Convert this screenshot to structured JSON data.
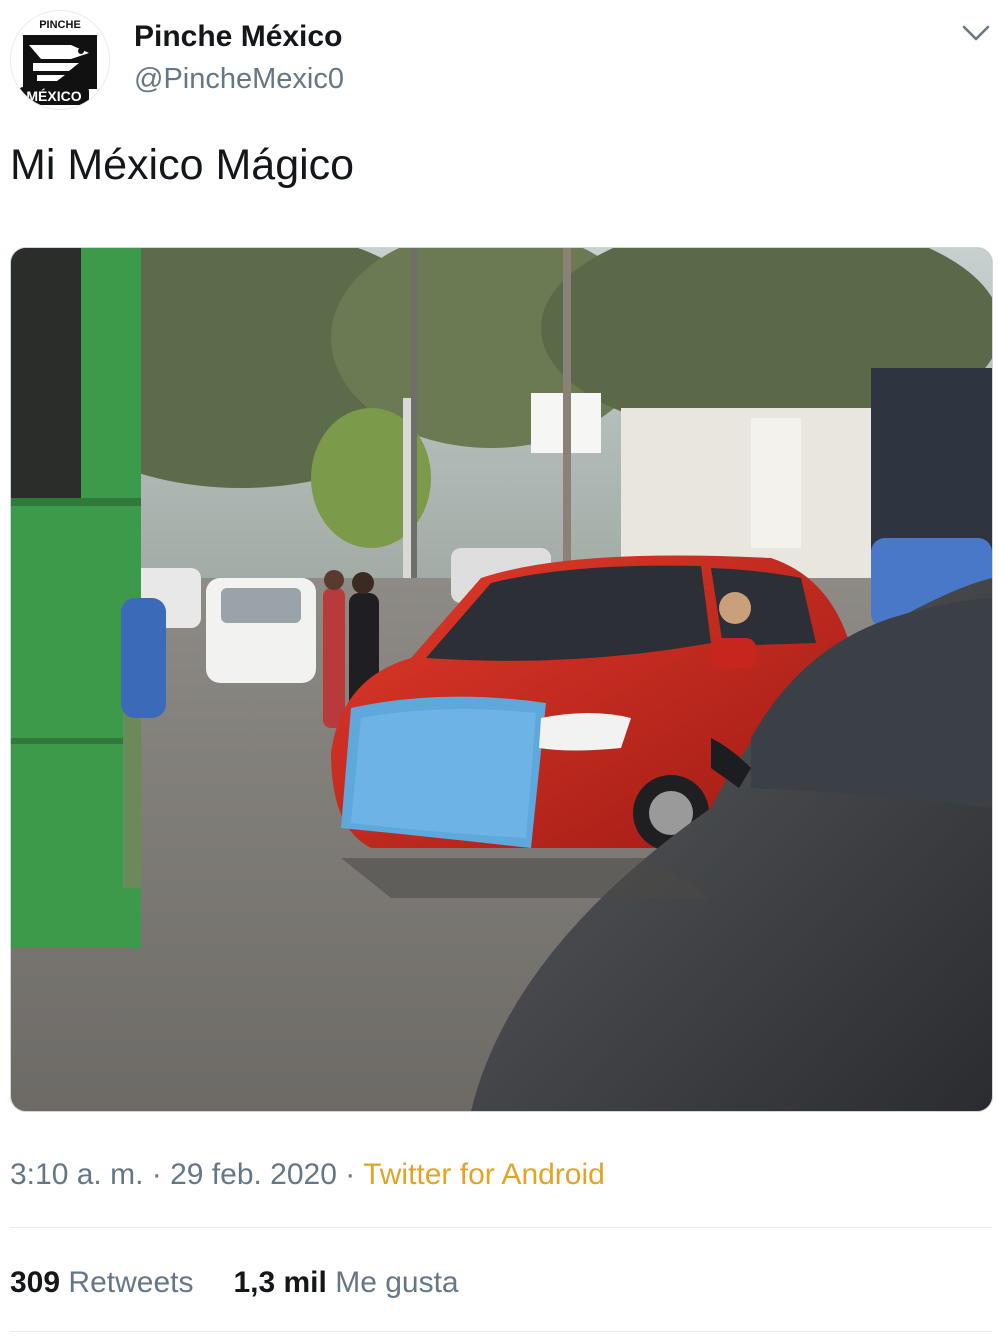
{
  "author": {
    "display_name": "Pinche México",
    "handle": "@PincheMexic0",
    "avatar_top_text": "PINCHE",
    "avatar_bottom_text": "MÉXICO"
  },
  "tweet": {
    "text": "Mi México Mágico"
  },
  "meta": {
    "time": "3:10 a. m.",
    "separator": "·",
    "date": "29 feb. 2020",
    "source": "Twitter for Android"
  },
  "stats": {
    "retweets_count": "309",
    "retweets_label": "Retweets",
    "likes_count": "1,3 mil",
    "likes_label": "Me gusta"
  },
  "icons": {
    "menu": "chevron-down-icon"
  },
  "colors": {
    "name": "#14171a",
    "secondary": "#657786",
    "source_link": "#e0a526",
    "border": "#e6ecf0"
  }
}
